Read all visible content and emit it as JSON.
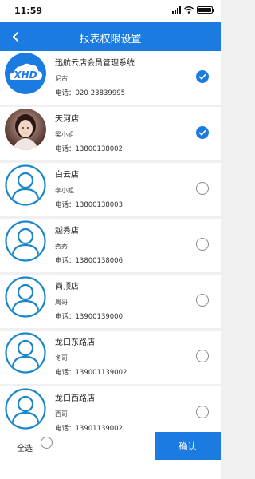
{
  "status_bar": {
    "time": "11:59"
  },
  "header": {
    "title": "报表权限设置"
  },
  "stores": [
    {
      "name": "迅航云店会员管理系统",
      "contact": "尼古",
      "phone": "电话：020-23839995",
      "selected": true,
      "avatar": "xhd-logo"
    },
    {
      "name": "天河店",
      "contact": "梁小姐",
      "phone": "电话：13800138002",
      "selected": true,
      "avatar": "photo"
    },
    {
      "name": "白云店",
      "contact": "李小姐",
      "phone": "电话：13800138003",
      "selected": false,
      "avatar": "person"
    },
    {
      "name": "越秀店",
      "contact": "秀秀",
      "phone": "电话：13800138006",
      "selected": false,
      "avatar": "person"
    },
    {
      "name": "岗顶店",
      "contact": "周哥",
      "phone": "电话：13900139000",
      "selected": false,
      "avatar": "person"
    },
    {
      "name": "龙口东路店",
      "contact": "冬哥",
      "phone": "电话：13900113900​2",
      "selected": false,
      "avatar": "person"
    },
    {
      "name": "龙口西路店",
      "contact": "西哥",
      "phone": "电话：13901139002",
      "selected": false,
      "avatar": "person"
    }
  ],
  "footer": {
    "select_all_label": "全选",
    "confirm_label": "确认"
  },
  "colors": {
    "accent": "#1c7be0",
    "background": "#f0f0f0"
  }
}
